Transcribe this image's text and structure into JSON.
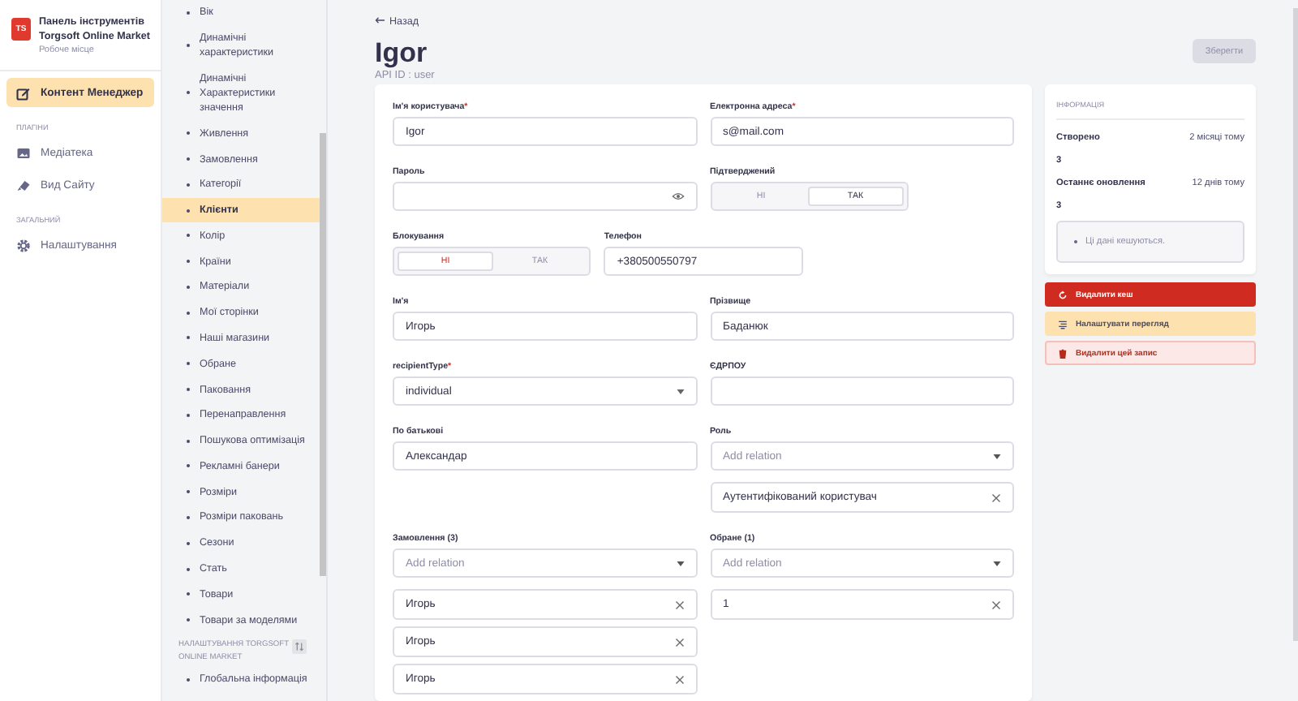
{
  "sidebar": {
    "brand": {
      "title": "Панель інструментів",
      "subtitle": "Torgsoft Online Market",
      "caption": "Робоче місце",
      "logo_text": "TS"
    },
    "nav": [
      {
        "kind": "item",
        "label": "Контент Менеджер",
        "selected": true
      },
      {
        "kind": "heading",
        "label": "ПЛАГІНИ"
      },
      {
        "kind": "item",
        "label": "Медіатека",
        "selected": false
      },
      {
        "kind": "item",
        "label": "Вид Сайту",
        "selected": false
      },
      {
        "kind": "heading",
        "label": "ЗАГАЛЬНИЙ"
      },
      {
        "kind": "item",
        "label": "Налаштування",
        "selected": false
      }
    ]
  },
  "collections": {
    "items": [
      {
        "label": "Вік",
        "selected": false
      },
      {
        "label": "Динамічні характеристики",
        "selected": false
      },
      {
        "label": "Динамічні Характеристики значення",
        "selected": false
      },
      {
        "label": "Живлення",
        "selected": false
      },
      {
        "label": "Замовлення",
        "selected": false
      },
      {
        "label": "Категорії",
        "selected": false
      },
      {
        "label": "Клієнти",
        "selected": true
      },
      {
        "label": "Колір",
        "selected": false
      },
      {
        "label": "Країни",
        "selected": false
      },
      {
        "label": "Матеріали",
        "selected": false
      },
      {
        "label": "Мої сторінки",
        "selected": false
      },
      {
        "label": "Наші магазини",
        "selected": false
      },
      {
        "label": "Обране",
        "selected": false
      },
      {
        "label": "Паковання",
        "selected": false
      },
      {
        "label": "Перенаправлення",
        "selected": false
      },
      {
        "label": "Пошукова оптимізація",
        "selected": false
      },
      {
        "label": "Рекламні банери",
        "selected": false
      },
      {
        "label": "Розміри",
        "selected": false
      },
      {
        "label": "Розміри паковань",
        "selected": false
      },
      {
        "label": "Сезони",
        "selected": false
      },
      {
        "label": "Стать",
        "selected": false
      },
      {
        "label": "Товари",
        "selected": false
      },
      {
        "label": "Товари за моделями",
        "selected": false
      }
    ],
    "section_heading": "НАЛАШТУВАННЯ TORGSOFT ONLINE MARKET",
    "section_items": [
      {
        "label": "Глобальна інформація",
        "selected": false
      }
    ]
  },
  "header": {
    "back": "Назад",
    "title": "Igor",
    "subtitle": "API ID : user",
    "save": "Зберегти"
  },
  "form": {
    "fields": [
      {
        "kind": "text",
        "label": "Ім'я користувача",
        "required_mark": "*",
        "value": "Igor"
      },
      {
        "kind": "text",
        "label": "Електронна адреса",
        "required_mark": "*",
        "value": "s@mail.com"
      },
      {
        "kind": "password",
        "label": "Пароль"
      },
      {
        "kind": "toggle",
        "label": "Підтверджений",
        "options": [
          {
            "label": "НІ",
            "selected": false
          },
          {
            "label": "ТАК",
            "selected": true
          }
        ]
      },
      {
        "kind": "toggle",
        "label": "Блокування",
        "options": [
          {
            "label": "НІ",
            "selected": true
          },
          {
            "label": "ТАК",
            "selected": false
          }
        ]
      },
      {
        "kind": "text",
        "label": "Телефон",
        "value": "+380500550797"
      },
      {
        "kind": "text",
        "label": "Ім'я",
        "value": "Игорь"
      },
      {
        "kind": "text",
        "label": "Прізвище",
        "value": "Баданюк"
      },
      {
        "kind": "select",
        "label": "recipientType",
        "required_mark": "*",
        "value": "individual"
      },
      {
        "kind": "text",
        "label": "ЄДРПОУ"
      },
      {
        "kind": "text",
        "label": "По батькові",
        "value": "Александар"
      },
      {
        "kind": "relation",
        "label": "Роль",
        "placeholder": "Add relation",
        "items": [
          "Аутентифікований користувач"
        ]
      },
      {
        "kind": "relation",
        "label": "Замовлення (3)",
        "placeholder": "Add relation",
        "items": [
          "Игорь",
          "Игорь",
          "Игорь"
        ]
      },
      {
        "kind": "relation",
        "label": "Обране (1)",
        "placeholder": "Add relation",
        "items": [
          "1"
        ]
      }
    ]
  },
  "info": {
    "heading": "ІНФОРМАЦІЯ",
    "rows": [
      {
        "label": "Створено",
        "value": "2 місяці тому",
        "detail": "3"
      },
      {
        "label": "Останнє оновлення",
        "value": "12 днів тому",
        "detail": "3"
      }
    ],
    "note": "Ці дані кешуються."
  },
  "actions": [
    {
      "kind": "danger",
      "label": "Видалити кеш"
    },
    {
      "kind": "warning",
      "label": "Налаштувати перегляд"
    },
    {
      "kind": "danger-light",
      "label": "Видалити цей запис"
    }
  ]
}
